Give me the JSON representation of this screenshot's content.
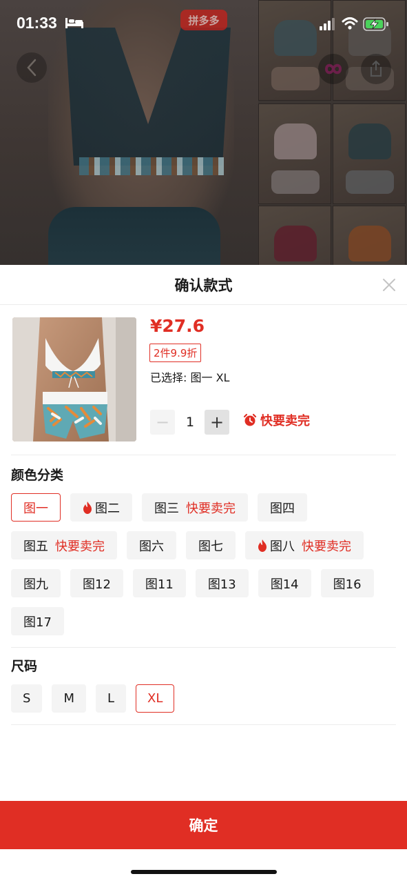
{
  "status": {
    "time": "01:33"
  },
  "app": {
    "logo": "拼多多"
  },
  "sheet": {
    "title": "确认款式"
  },
  "product": {
    "price": "¥27.6",
    "discount": "2件9.9折",
    "selected": "已选择: 图一 XL",
    "quantity": "1",
    "sellout": "快要卖完"
  },
  "color_section": {
    "title": "颜色分类",
    "options": [
      {
        "label": "图一",
        "tag": "",
        "hot": false,
        "active": true
      },
      {
        "label": "图二",
        "tag": "",
        "hot": true,
        "active": false
      },
      {
        "label": "图三",
        "tag": "快要卖完",
        "hot": false,
        "active": false
      },
      {
        "label": "图四",
        "tag": "",
        "hot": false,
        "active": false
      },
      {
        "label": "图五",
        "tag": "快要卖完",
        "hot": false,
        "active": false
      },
      {
        "label": "图六",
        "tag": "",
        "hot": false,
        "active": false
      },
      {
        "label": "图七",
        "tag": "",
        "hot": false,
        "active": false
      },
      {
        "label": "图八",
        "tag": "快要卖完",
        "hot": true,
        "active": false
      },
      {
        "label": "图九",
        "tag": "",
        "hot": false,
        "active": false
      },
      {
        "label": "图12",
        "tag": "",
        "hot": false,
        "active": false
      },
      {
        "label": "图11",
        "tag": "",
        "hot": false,
        "active": false
      },
      {
        "label": "图13",
        "tag": "",
        "hot": false,
        "active": false
      },
      {
        "label": "图14",
        "tag": "",
        "hot": false,
        "active": false
      },
      {
        "label": "图16",
        "tag": "",
        "hot": false,
        "active": false
      },
      {
        "label": "图17",
        "tag": "",
        "hot": false,
        "active": false
      }
    ]
  },
  "size_section": {
    "title": "尺码",
    "options": [
      {
        "label": "S",
        "active": false
      },
      {
        "label": "M",
        "active": false
      },
      {
        "label": "L",
        "active": false
      },
      {
        "label": "XL",
        "active": true
      }
    ]
  },
  "confirm_label": "确定",
  "colors": {
    "accent": "#e02e24",
    "option_bg": "#f4f4f4",
    "sheet_bg": "#ffffff"
  },
  "icons": [
    "bed-icon",
    "signal-icon",
    "wifi-icon",
    "battery-icon",
    "back-arrow-icon",
    "share-icon",
    "close-icon",
    "alarm-clock-icon",
    "flame-icon"
  ]
}
